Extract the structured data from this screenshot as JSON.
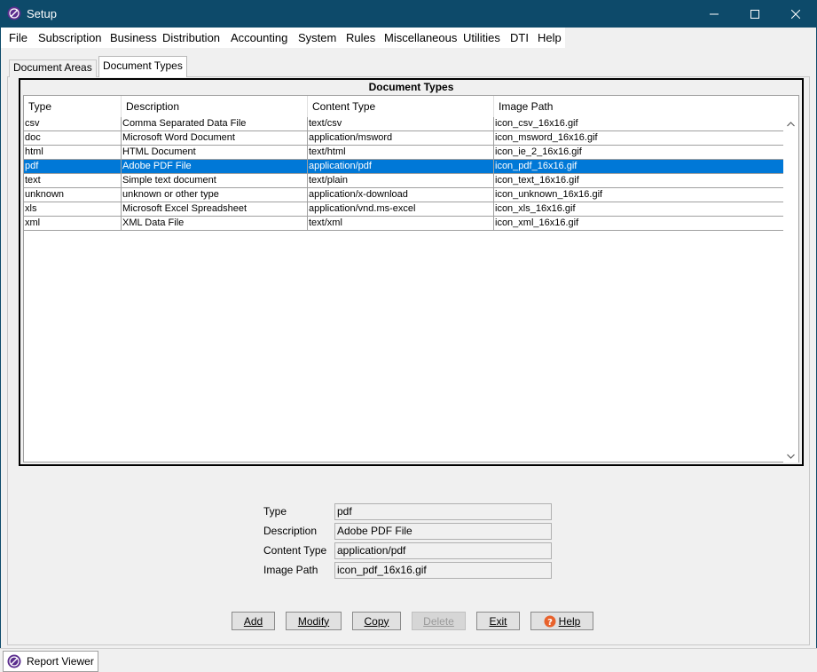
{
  "window": {
    "title": "Setup",
    "controls": [
      "minimize-icon",
      "maximize-icon",
      "close-icon"
    ]
  },
  "menu": [
    "File",
    "Subscription",
    "Business",
    "Distribution",
    "Accounting",
    "System",
    "Rules",
    "Miscellaneous",
    "Utilities",
    "DTI",
    "Help"
  ],
  "tabs": [
    {
      "label": "Document Areas",
      "active": false
    },
    {
      "label": "Document Types",
      "active": true
    }
  ],
  "table": {
    "title": "Document Types",
    "columns": [
      "Type",
      "Description",
      "Content Type",
      "Image Path"
    ],
    "rows": [
      {
        "type": "csv",
        "description": "Comma Separated Data File",
        "content_type": "text/csv",
        "image_path": "icon_csv_16x16.gif",
        "selected": false
      },
      {
        "type": "doc",
        "description": "Microsoft Word Document",
        "content_type": "application/msword",
        "image_path": "icon_msword_16x16.gif",
        "selected": false
      },
      {
        "type": "html",
        "description": "HTML Document",
        "content_type": "text/html",
        "image_path": "icon_ie_2_16x16.gif",
        "selected": false
      },
      {
        "type": "pdf",
        "description": "Adobe PDF File",
        "content_type": "application/pdf",
        "image_path": "icon_pdf_16x16.gif",
        "selected": true
      },
      {
        "type": "text",
        "description": "Simple text document",
        "content_type": "text/plain",
        "image_path": "icon_text_16x16.gif",
        "selected": false
      },
      {
        "type": "unknown",
        "description": "unknown or other type",
        "content_type": "application/x-download",
        "image_path": "icon_unknown_16x16.gif",
        "selected": false
      },
      {
        "type": "xls",
        "description": "Microsoft Excel Spreadsheet",
        "content_type": "application/vnd.ms-excel",
        "image_path": "icon_xls_16x16.gif",
        "selected": false
      },
      {
        "type": "xml",
        "description": "XML Data File",
        "content_type": "text/xml",
        "image_path": "icon_xml_16x16.gif",
        "selected": false
      }
    ]
  },
  "form": {
    "type_label": "Type",
    "type_value": "pdf",
    "description_label": "Description",
    "description_value": "Adobe PDF File",
    "content_type_label": "Content Type",
    "content_type_value": "application/pdf",
    "image_path_label": "Image Path",
    "image_path_value": "icon_pdf_16x16.gif"
  },
  "buttons": {
    "add": "Add",
    "modify": "Modify",
    "copy": "Copy",
    "delete": "Delete",
    "exit": "Exit",
    "help": "Help"
  },
  "taskbar": {
    "item_label": "Report Viewer"
  },
  "colors": {
    "titlebar": "#0d4a6a",
    "selection": "#0078d7"
  }
}
